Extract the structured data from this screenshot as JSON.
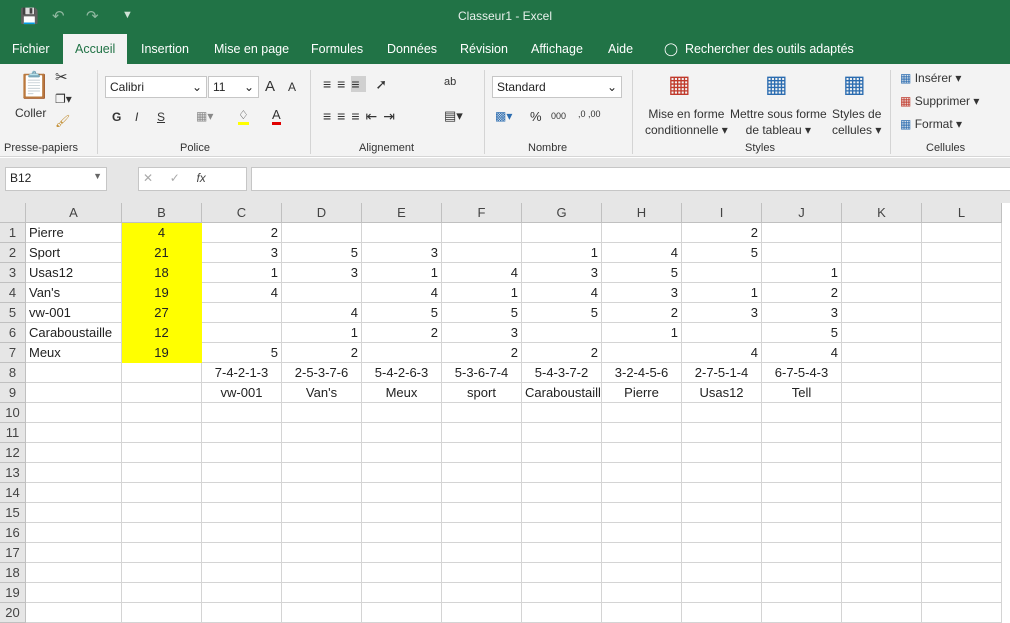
{
  "window": {
    "title": "Classeur1  -  Excel"
  },
  "quick_access": {
    "save_icon": "save-icon",
    "undo_icon": "undo-icon",
    "redo_icon": "redo-icon",
    "customize_icon": "chevron-down-icon"
  },
  "tabs": [
    {
      "label": "Fichier"
    },
    {
      "label": "Accueil",
      "active": true
    },
    {
      "label": "Insertion"
    },
    {
      "label": "Mise en page"
    },
    {
      "label": "Formules"
    },
    {
      "label": "Données"
    },
    {
      "label": "Révision"
    },
    {
      "label": "Affichage"
    },
    {
      "label": "Aide"
    }
  ],
  "search": {
    "label": "Rechercher des outils adaptés"
  },
  "ribbon": {
    "clipboard": {
      "paste": "Coller",
      "label": "Presse-papiers"
    },
    "font": {
      "name": "Calibri",
      "size": "11",
      "bold": "G",
      "italic": "I",
      "underline": "S",
      "label": "Police",
      "fill_color": "#ffff00",
      "font_color": "#e00000"
    },
    "alignment": {
      "label": "Alignement"
    },
    "number": {
      "format": "Standard",
      "percent": "%",
      "thousands": "000",
      "label": "Nombre"
    },
    "styles": {
      "conditional": "Mise en forme",
      "conditional2": "conditionnelle",
      "table": "Mettre sous forme",
      "table2": "de tableau",
      "cell_styles": "Styles de",
      "cell_styles2": "cellules",
      "label": "Styles"
    },
    "cells": {
      "insert": "Insérer",
      "delete": "Supprimer",
      "format": "Format",
      "label": "Cellules"
    }
  },
  "formula_bar": {
    "name_box": "B12",
    "fx": "fx",
    "value": ""
  },
  "sheet": {
    "columns": [
      "A",
      "B",
      "C",
      "D",
      "E",
      "F",
      "G",
      "H",
      "I",
      "J",
      "K",
      "L"
    ],
    "row_numbers": [
      "1",
      "2",
      "3",
      "4",
      "5",
      "6",
      "7",
      "8",
      "9",
      "10",
      "11",
      "12",
      "13",
      "14",
      "15",
      "16",
      "17",
      "18",
      "19",
      "20"
    ],
    "highlight_color": "#ffff00",
    "rows": [
      [
        "Pierre",
        "4",
        "2",
        "",
        "",
        "",
        "",
        "",
        "2",
        ""
      ],
      [
        "Sport",
        "21",
        "3",
        "5",
        "3",
        "",
        "1",
        "4",
        "5",
        ""
      ],
      [
        "Usas12",
        "18",
        "1",
        "3",
        "1",
        "4",
        "3",
        "5",
        "",
        "1"
      ],
      [
        "Van's",
        "19",
        "4",
        "",
        "4",
        "1",
        "4",
        "3",
        "1",
        "2"
      ],
      [
        "vw-001",
        "27",
        "",
        "4",
        "5",
        "5",
        "5",
        "2",
        "3",
        "3"
      ],
      [
        "Caraboustaille",
        "12",
        "",
        "1",
        "2",
        "3",
        "",
        "1",
        "",
        "5"
      ],
      [
        "Meux",
        "19",
        "5",
        "2",
        "",
        "2",
        "2",
        "",
        "4",
        "4"
      ],
      [
        "",
        "",
        "7-4-2-1-3",
        "2-5-3-7-6",
        "5-4-2-6-3",
        "5-3-6-7-4",
        "5-4-3-7-2",
        "3-2-4-5-6",
        "2-7-5-1-4",
        "6-7-5-4-3"
      ],
      [
        "",
        "",
        "vw-001",
        "Van's",
        "Meux",
        "sport",
        "Caraboustaille",
        "Pierre",
        "Usas12",
        "Tell"
      ]
    ]
  }
}
